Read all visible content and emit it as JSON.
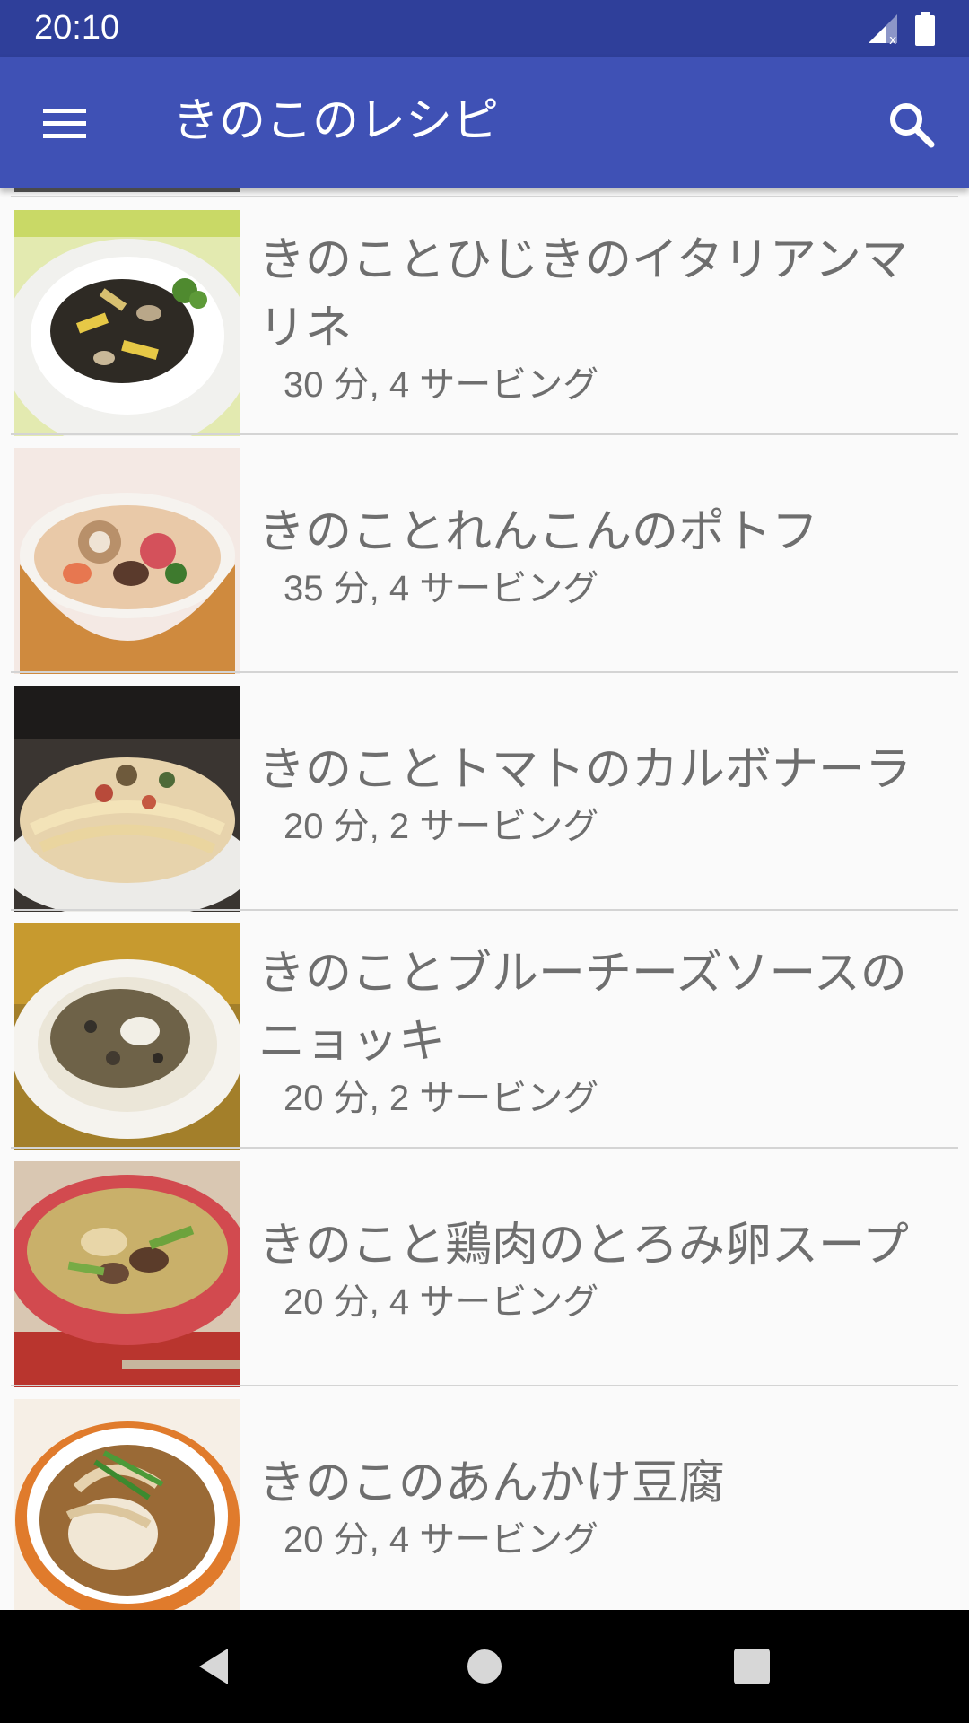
{
  "status_bar": {
    "time": "20:10"
  },
  "app_bar": {
    "title": "きのこのレシピ",
    "menu_icon": "hamburger-menu-icon",
    "search_icon": "search-icon"
  },
  "recipes": [
    {
      "title": "きのことひじきのイタリアンマリネ",
      "meta": "30 分, 4 サービング"
    },
    {
      "title": "きのことれんこんのポトフ",
      "meta": "35 分, 4 サービング"
    },
    {
      "title": "きのことトマトのカルボナーラ",
      "meta": "20 分, 2 サービング"
    },
    {
      "title": "きのことブルーチーズソースのニョッキ",
      "meta": "20 分, 2 サービング"
    },
    {
      "title": "きのこと鶏肉のとろみ卵スープ",
      "meta": "20 分, 4 サービング"
    },
    {
      "title": "きのこのあんかけ豆腐",
      "meta": "20 分, 4 サービング"
    }
  ],
  "nav_bar": {
    "back_icon": "back-triangle-icon",
    "home_icon": "home-circle-icon",
    "recents_icon": "recents-square-icon"
  },
  "colors": {
    "status_bar": "#2f3f9a",
    "app_bar": "#3f51b5",
    "background": "#fafafa",
    "text": "#6e6e6e"
  }
}
